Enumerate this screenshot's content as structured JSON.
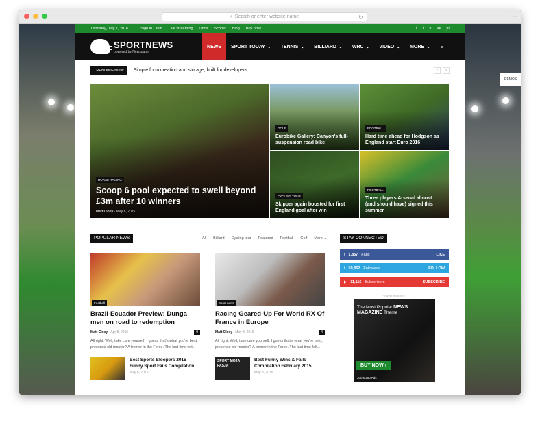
{
  "browser": {
    "url_placeholder": "Search or enter website name",
    "new_tab": "+"
  },
  "topbar": {
    "date": "Thursday, July 7, 2016",
    "links": [
      "Sign in / Join",
      "Live streaming",
      "Odds",
      "Scores",
      "Blog",
      "Buy now!"
    ],
    "social": [
      "f",
      "t",
      "v",
      "vk",
      "yt"
    ]
  },
  "header": {
    "logo_title": "SPORTNEWS",
    "logo_sub": "powered by Newspaper",
    "nav": [
      {
        "label": "NEWS",
        "active": true,
        "caret": ""
      },
      {
        "label": "SPORT TODAY",
        "caret": "⌄"
      },
      {
        "label": "TENNIS",
        "caret": "⌄"
      },
      {
        "label": "BILLIARD",
        "caret": "⌄"
      },
      {
        "label": "WRC",
        "caret": "⌄"
      },
      {
        "label": "VIDEO",
        "caret": "⌄"
      },
      {
        "label": "MORE",
        "caret": "⌄"
      }
    ],
    "search_icon": "⌕"
  },
  "trending": {
    "badge": "TRENDING NOW",
    "text": "Simple form creation and storage, built for developers",
    "prev": "‹",
    "next": "›"
  },
  "featured": [
    {
      "cat": "HORSE RACING",
      "title": "Scoop 6 pool expected to swell beyond £3m after 10 winners",
      "author": "Matt Cloey",
      "sep": "-",
      "date": "May 8, 2015"
    },
    {
      "cat": "GOLF",
      "title": "Eurobike Gallery: Canyon's full-suspension road bike"
    },
    {
      "cat": "FOOTBALL",
      "title": "Hard time ahead for Hodgson as England start Euro 2016"
    },
    {
      "cat": "CYCLING TOUR",
      "title": "Skipper again boosted for first England goal after win"
    },
    {
      "cat": "FOOTBALL",
      "title": "Three players Arsenal almost (and should have) signed this summer"
    }
  ],
  "popular": {
    "title": "POPULAR NEWS",
    "filters": [
      "All",
      "Billiard",
      "Cycling tour",
      "Featured",
      "Football",
      "Golf",
      "More ⌄"
    ],
    "cards": [
      {
        "cat": "Football",
        "title": "Brazil-Ecuador Preview: Dunga men on road to redemption",
        "author": "Matt Cloey",
        "date": "Apr 8, 2015",
        "count": "0",
        "excerpt": "All right. Well, take care yourself. I guess that's what you're best, presence old master? A tremor in the Force. The last time felt..."
      },
      {
        "cat": "Sport news",
        "title": "Racing Geared-Up For World RX Of France in Europe",
        "author": "Matt Cloey",
        "date": "May 8, 2015",
        "count": "4",
        "excerpt": "All right. Well, take care yourself. I guess that's what you're best, presence old master? A tremor in the Force. The last time felt..."
      }
    ],
    "minis": [
      {
        "title": "Best Sports Bloopers 2015 Funny Sport Fails Compilation",
        "date": "May 8, 2015"
      },
      {
        "title": "Best Funny Wins & Fails Compilation February 2015",
        "date": "May 8, 2015",
        "thumb_text": "SPORT MOJA PASJA"
      }
    ]
  },
  "stay": {
    "title": "STAY CONNECTED",
    "rows": [
      {
        "icon": "f",
        "count": "1,857",
        "label": "Fans",
        "action": "LIKE",
        "color": "#3b5998"
      },
      {
        "icon": "t",
        "count": "59,852",
        "label": "Followers",
        "action": "FOLLOW",
        "color": "#2ea6e0"
      },
      {
        "icon": "▶",
        "count": "11,116",
        "label": "Subscribers",
        "action": "SUBSCRIBE",
        "color": "#e53935"
      }
    ]
  },
  "ad": {
    "label": "- Advertisement -",
    "line1": "The Most Popular",
    "line1b": "NEWS",
    "line2": "MAGAZINE",
    "line2b": "Theme",
    "buy": "BUY NOW ›",
    "size": "300 x 250 Ads"
  },
  "demos": "DEMOS"
}
